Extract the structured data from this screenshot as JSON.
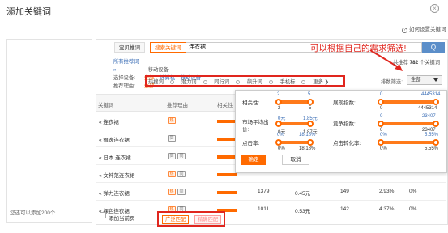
{
  "dialog": {
    "title": "添加关键词",
    "close_glyph": "×",
    "help_link": "如何设置关键词",
    "help_glyph": "?"
  },
  "left": {
    "footer_text": "您还可以添加200个"
  },
  "search": {
    "tab_recommend": "宝贝推词",
    "tab_search": "搜索关键词",
    "query": "连衣裙",
    "button_glyph": "Q",
    "callout": "可以根据自己的需求筛选!"
  },
  "filters": {
    "all_recommend_label": "所有推荐词 »",
    "all_recommend_value": "移动设备",
    "device_label": "选择设备:",
    "device_options": [
      "全部",
      "计算机",
      "移动设备"
    ],
    "reason_label": "推荐理由:",
    "reason_selected": "全部",
    "reasons": [
      "热搜词",
      "潜力词",
      "同行词",
      "飙升词",
      "手机标"
    ],
    "more": "更多 ❯",
    "total_prefix": "共推荐",
    "total_count": "782",
    "total_suffix": "个关键词",
    "sort_label": "排数筛选:",
    "sort_value": "全部"
  },
  "table": {
    "headers": [
      "关键词",
      "推荐理由",
      "相关性"
    ],
    "rows": [
      {
        "keyword": "« 连衣裙",
        "tags": [
          "热"
        ],
        "tag_colors": [
          "o"
        ],
        "vals": [
          "",
          "",
          "",
          "",
          ""
        ]
      },
      {
        "keyword": "« 飘逸连衣裙",
        "tags": [
          "同"
        ],
        "tag_colors": [
          "g"
        ],
        "vals": [
          "",
          "",
          "",
          "",
          ""
        ]
      },
      {
        "keyword": "« 日本 连衣裙",
        "tags": [
          "同",
          "同"
        ],
        "tag_colors": [
          "g",
          "g"
        ],
        "vals": [
          "",
          "",
          "",
          "",
          ""
        ]
      },
      {
        "keyword": "« 女神范连衣裙",
        "tags": [
          "热",
          "同"
        ],
        "tag_colors": [
          "o",
          "g"
        ],
        "vals": [
          "14099",
          "4.71元",
          "567",
          "3.37%",
          "0.00%"
        ]
      },
      {
        "keyword": "« 弹力连衣裙",
        "tags": [
          "热",
          "同"
        ],
        "tag_colors": [
          "o",
          "g"
        ],
        "vals": [
          "1379",
          "0.45元",
          "149",
          "2.93%",
          "0%"
        ]
      },
      {
        "keyword": "« 裸色连衣裙",
        "tags": [
          "热",
          "同"
        ],
        "tag_colors": [
          "o",
          "g"
        ],
        "vals": [
          "1011",
          "0.53元",
          "142",
          "4.37%",
          "0%"
        ]
      }
    ]
  },
  "popup": {
    "relevance": {
      "label": "相关性:",
      "min": "2",
      "max": "5",
      "min_top": "2",
      "max_top": "5"
    },
    "impressions": {
      "label": "展现指数:",
      "min": "0",
      "max": "4445314",
      "min_top": "0",
      "max_top": "4445314"
    },
    "avg_price": {
      "label": "市场平均出价:",
      "min": "0元",
      "max": "1.87元",
      "min_top": "0元",
      "max_top": "1.85元"
    },
    "competition": {
      "label": "竞争指数:",
      "min": "0",
      "max": "23407",
      "min_top": "0",
      "max_top": "23407"
    },
    "ctr": {
      "label": "点击率:",
      "min": "0%",
      "max": "18.18%",
      "min_top": "0%",
      "max_top": "18.18%"
    },
    "cvr": {
      "label": "点击转化率:",
      "min": "0%",
      "max": "5.55%",
      "min_top": "0%",
      "max_top": "5.55%"
    },
    "ok": "确定",
    "cancel": "取消"
  },
  "footer": {
    "add_page": "添加当前页",
    "btn_broad": "广泛匹配",
    "btn_phrase": "精确匹配"
  },
  "colors": {
    "accent": "#ff6a00",
    "callout": "#e0261e",
    "search_button": "#5b8ec9"
  }
}
